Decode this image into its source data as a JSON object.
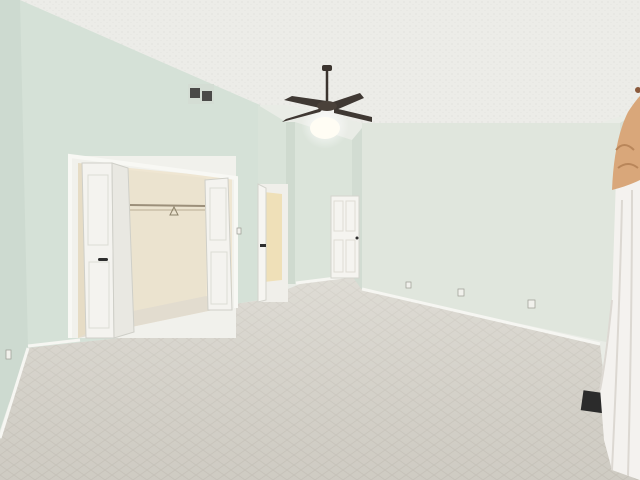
{
  "scene": {
    "description_free": true,
    "colors": {
      "ceiling": "#eeeeea",
      "wall_left": "#d6e2d8",
      "wall_back": "#dfe6dd",
      "wall_right": "#e3e8df",
      "carpet": "#d7d4cc",
      "trim": "#f2f2ee",
      "door": "#f3f2ee",
      "closet_interior": "#ece3cf",
      "fan": "#3b342f",
      "light": "#fffdf3",
      "vent": "#2b2b2b",
      "curtain": "#f4f2ef",
      "valance": "#d9a77a"
    },
    "icons": {
      "fan": "ceiling-fan-icon",
      "vent": "floor-vent-icon",
      "outlet": "power-outlet-icon"
    }
  }
}
